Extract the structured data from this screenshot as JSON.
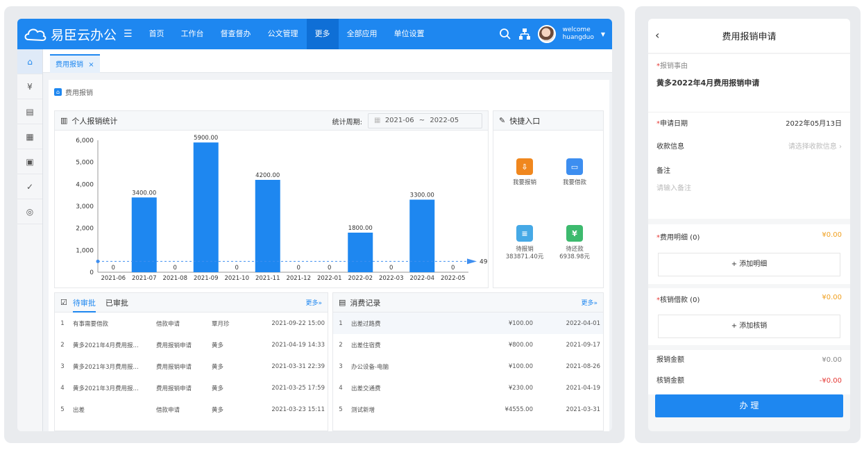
{
  "app": {
    "name": "易臣云办公",
    "user_welcome": "welcome",
    "user_name": "huangduo"
  },
  "nav": [
    "首页",
    "工作台",
    "督查督办",
    "公文管理",
    "更多",
    "全部应用",
    "单位设置"
  ],
  "tab": {
    "label": "费用报销",
    "close": "×"
  },
  "breadcrumb": "费用报销",
  "stats": {
    "title": "个人报销统计",
    "period_label": "统计周期:",
    "period_from": "2021-06",
    "period_sep": "~",
    "period_to": "2022-05",
    "avg_label": "491.67"
  },
  "chart_data": {
    "type": "bar",
    "categories": [
      "2021-06",
      "2021-07",
      "2021-08",
      "2021-09",
      "2021-10",
      "2021-11",
      "2021-12",
      "2022-01",
      "2022-02",
      "2022-03",
      "2022-04",
      "2022-05"
    ],
    "values": [
      0,
      3400,
      0,
      5900,
      0,
      4200,
      0,
      0,
      1800,
      0,
      3300,
      0
    ],
    "value_labels": [
      "0",
      "3400.00",
      "0",
      "5900.00",
      "0",
      "4200.00",
      "0",
      "0",
      "1800.00",
      "0",
      "3300.00",
      "0"
    ],
    "ylim": [
      0,
      6000
    ],
    "yticks": [
      "0",
      "1,000",
      "2,000",
      "3,000",
      "4,000",
      "5,000",
      "6,000"
    ],
    "average": 491.67,
    "bar_color": "#1e87f0"
  },
  "quick": {
    "title": "快捷入口",
    "items": [
      {
        "label": "我要报销",
        "color": "#f0871e"
      },
      {
        "label": "我要借款",
        "color": "#3d8ef0"
      },
      {
        "label": "待报销",
        "sub": "383871.40元",
        "color": "#46a9e6"
      },
      {
        "label": "待还款",
        "sub": "6938.98元",
        "color": "#3dba6e"
      }
    ]
  },
  "approvals": {
    "tab_pending": "待审批",
    "tab_done": "已审批",
    "more": "更多»",
    "rows": [
      [
        "1",
        "有事需要借款",
        "借款申请",
        "覃月珍",
        "2021-09-22 15:00"
      ],
      [
        "2",
        "黄多2021年4月费用报...",
        "费用报销申请",
        "黄多",
        "2021-04-19 14:33"
      ],
      [
        "3",
        "黄多2021年3月费用报...",
        "费用报销申请",
        "黄多",
        "2021-03-31 22:39"
      ],
      [
        "4",
        "黄多2021年3月费用报...",
        "费用报销申请",
        "黄多",
        "2021-03-25 17:59"
      ],
      [
        "5",
        "出差",
        "借款申请",
        "黄多",
        "2021-03-23 15:11"
      ]
    ]
  },
  "consumption": {
    "title": "消费记录",
    "more": "更多»",
    "rows": [
      [
        "1",
        "出差过路费",
        "¥100.00",
        "2022-04-01"
      ],
      [
        "2",
        "出差住宿费",
        "¥800.00",
        "2021-09-17"
      ],
      [
        "3",
        "办公设备-电脑",
        "¥100.00",
        "2021-08-26"
      ],
      [
        "4",
        "出差交通费",
        "¥230.00",
        "2021-04-19"
      ],
      [
        "5",
        "测试新增",
        "¥4555.00",
        "2021-03-31"
      ]
    ]
  },
  "mobile": {
    "title": "费用报销申请",
    "reason_label": "报销事由",
    "reason_value": "黄多2022年4月费用报销申请",
    "date_label": "申请日期",
    "date_value": "2022年05月13日",
    "payee_label": "收款信息",
    "payee_placeholder": "请选择收款信息",
    "note_label": "备注",
    "note_placeholder": "请输入备注",
    "detail_label": "费用明细 (0)",
    "detail_amount": "¥0.00",
    "add_detail": "+ 添加明细",
    "loan_label": "核销借款 (0)",
    "loan_amount": "¥0.00",
    "add_loan": "+ 添加核销",
    "reimburse_label": "报销金额",
    "reimburse_value": "¥0.00",
    "writeoff_label": "核销金额",
    "writeoff_value": "-¥0.00",
    "submit": "办 理"
  }
}
